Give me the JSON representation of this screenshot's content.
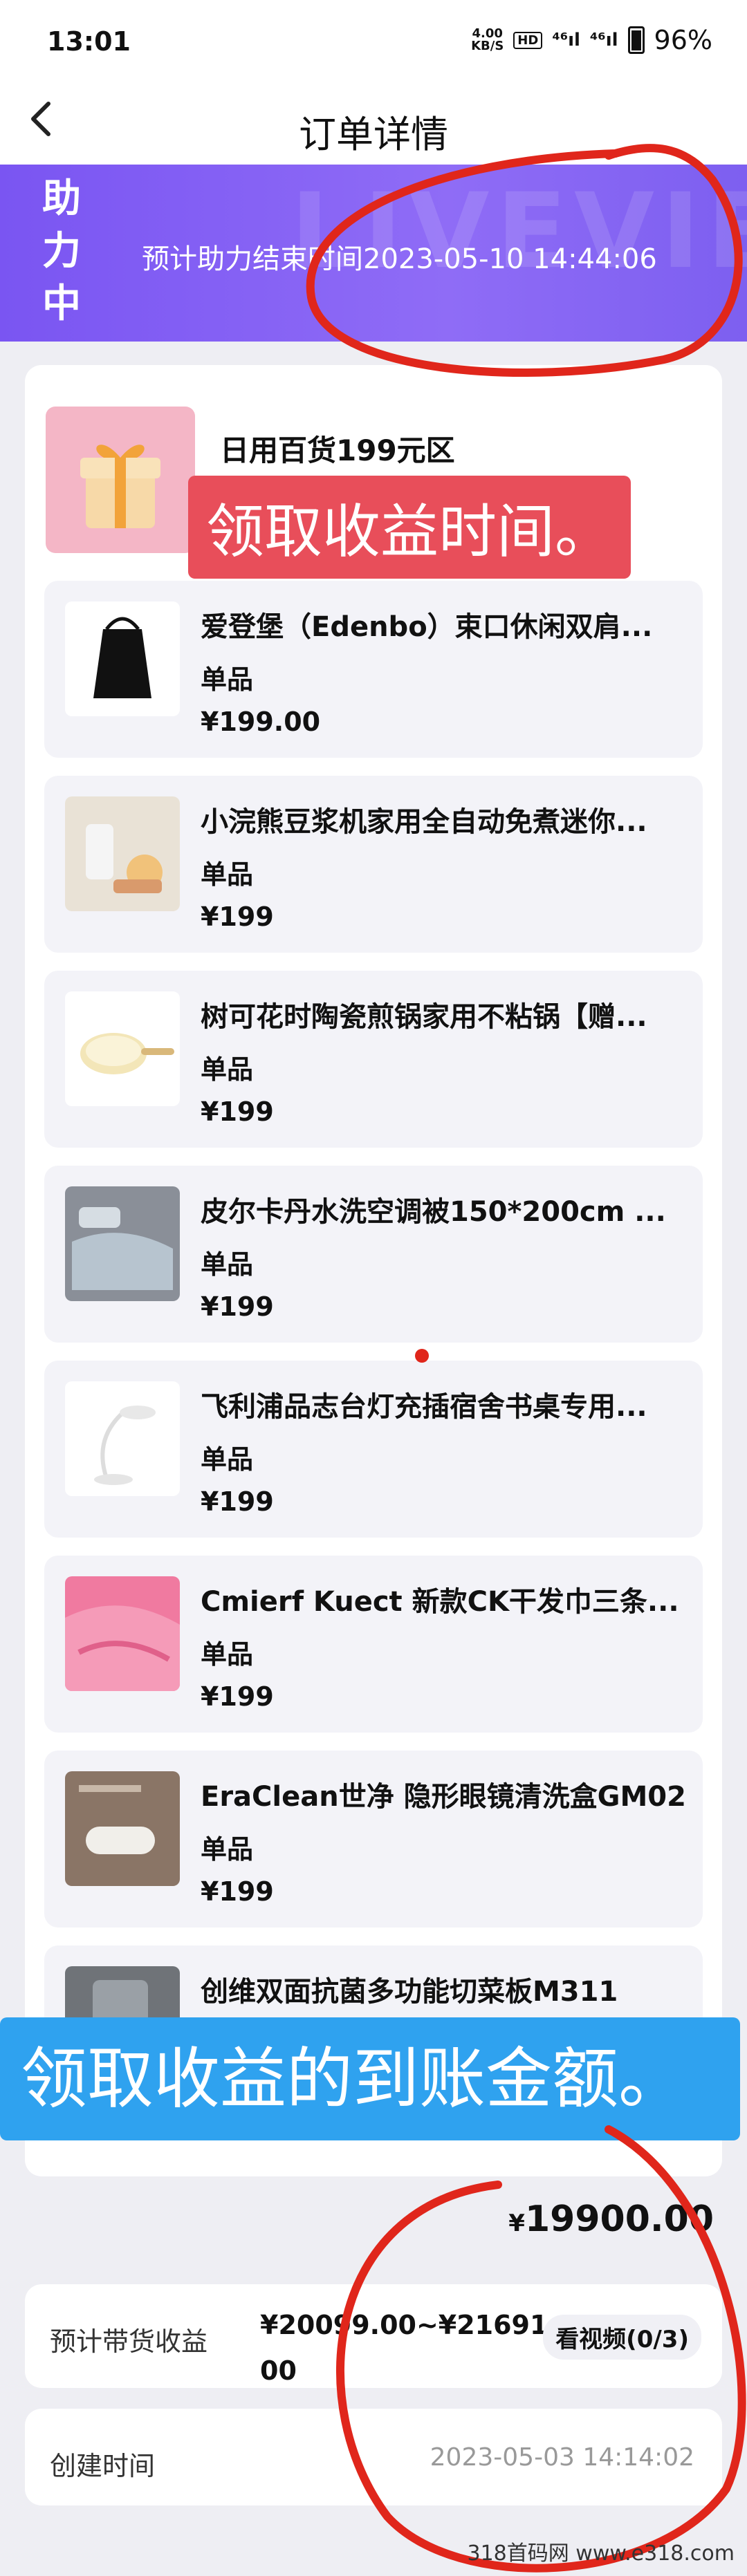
{
  "status": {
    "time": "13:01",
    "speed_num": "4.00",
    "speed_unit": "KB/S",
    "hd": "HD",
    "sig1": "⁴⁶ıl",
    "sig2": "⁴⁶ıl",
    "battery": "96%"
  },
  "nav": {
    "back_glyph": "‹",
    "title": "订单详情"
  },
  "banner": {
    "tag_chars": [
      "助",
      "力",
      "中"
    ],
    "text": "预计助力结束时间2023-05-10 14:44:06",
    "watermark": "LIVEVIEWER"
  },
  "shop": {
    "name": "日用百货199元区"
  },
  "items": [
    {
      "title": "爱登堡（Edenbo）束口休闲双肩...",
      "type": "单品",
      "price": "¥199.00",
      "icon": "backpack-icon"
    },
    {
      "title": "小浣熊豆浆机家用全自动免煮迷你...",
      "type": "单品",
      "price": "¥199",
      "icon": "soymilk-maker-icon"
    },
    {
      "title": "树可花时陶瓷煎锅家用不粘锅【赠...",
      "type": "单品",
      "price": "¥199",
      "icon": "frying-pan-icon"
    },
    {
      "title": "皮尔卡丹水洗空调被150*200cm ...",
      "type": "单品",
      "price": "¥199",
      "icon": "quilt-icon"
    },
    {
      "title": "飞利浦品志台灯充插宿舍书桌专用...",
      "type": "单品",
      "price": "¥199",
      "icon": "desk-lamp-icon"
    },
    {
      "title": "Cmierf Kuect 新款CK干发巾三条...",
      "type": "单品",
      "price": "¥199",
      "icon": "towel-icon"
    },
    {
      "title": "EraClean世净 隐形眼镜清洗盒GM02",
      "type": "单品",
      "price": "¥199",
      "icon": "lens-cleaner-icon"
    },
    {
      "title": "创维双面抗菌多功能切菜板M311",
      "type": "单品",
      "price": "",
      "icon": "cutting-board-icon"
    }
  ],
  "annotations": {
    "time_note": "领取收益时间。",
    "amount_note": "领取收益的到账金额。"
  },
  "total": {
    "currency": "¥",
    "amount": "19900.00"
  },
  "income": {
    "label": "预计带货收益",
    "value": "¥20099.00~¥21691.00",
    "video_btn": "看视频(0/3)"
  },
  "created": {
    "label": "创建时间",
    "value": "2023-05-03 14:14:02"
  },
  "footer": {
    "watermark": "318首码网  www.e318.com"
  },
  "colors": {
    "banner": "#7a55f2",
    "red_note": "#e84e5a",
    "blue_note": "#2fa2ef",
    "scribble": "#e0261b"
  }
}
